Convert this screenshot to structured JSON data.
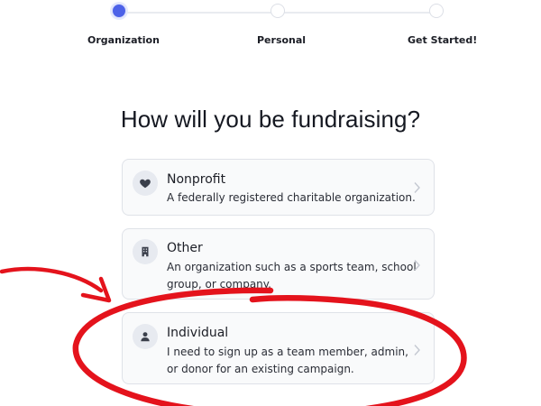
{
  "stepper": {
    "steps": [
      {
        "label": "Organization",
        "active": true
      },
      {
        "label": "Personal",
        "active": false
      },
      {
        "label": "Get Started!",
        "active": false
      }
    ]
  },
  "heading": "How will you be fundraising?",
  "options": [
    {
      "icon": "heart-icon",
      "title": "Nonprofit",
      "description": "A federally registered charitable organization."
    },
    {
      "icon": "building-icon",
      "title": "Other",
      "description": "An organization such as a sports team, school group, or company."
    },
    {
      "icon": "person-icon",
      "title": "Individual",
      "description": "I need to sign up as a team member, admin, or donor for an existing campaign."
    }
  ],
  "colors": {
    "accent": "#4d62e8",
    "annotation": "#e4131c"
  }
}
